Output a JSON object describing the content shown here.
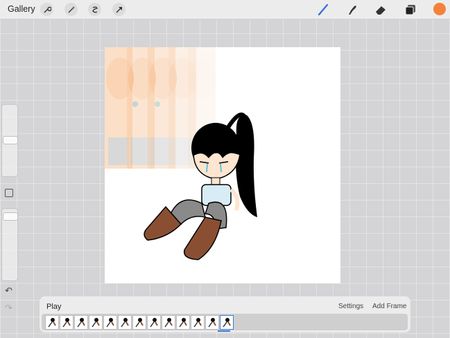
{
  "topbar": {
    "gallery_label": "Gallery",
    "left_tools": [
      "wrench-icon",
      "magic-wand-icon",
      "selection-icon",
      "transform-arrow-icon"
    ],
    "right_tools": [
      "brush-icon",
      "smudge-icon",
      "eraser-icon",
      "layers-icon"
    ],
    "current_color": "#f4813b",
    "accent": "#2f6fd6"
  },
  "animation": {
    "play_label": "Play",
    "settings_label": "Settings",
    "add_frame_label": "Add Frame",
    "frame_count": 13,
    "active_frame": 13
  }
}
